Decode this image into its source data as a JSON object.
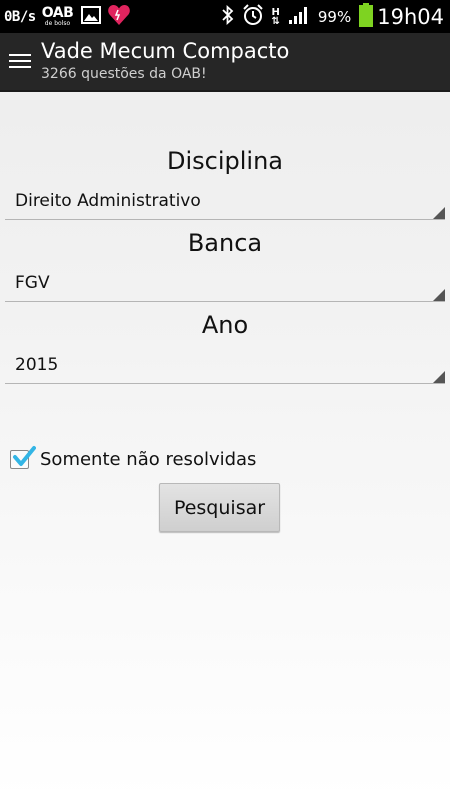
{
  "status_bar": {
    "speed": "0B/s",
    "oab_text": "OAB",
    "oab_small": "de bolso",
    "battery_percent": "99%",
    "time": "19h04",
    "network_type": "H",
    "icons": [
      "image-icon",
      "heart-icon",
      "bluetooth-icon",
      "alarm-icon",
      "signal-icon",
      "battery-icon"
    ]
  },
  "app_bar": {
    "title": "Vade Mecum Compacto",
    "subtitle": "3266 questões da OAB!"
  },
  "form": {
    "disciplina": {
      "label": "Disciplina",
      "value": "Direito Administrativo"
    },
    "banca": {
      "label": "Banca",
      "value": "FGV"
    },
    "ano": {
      "label": "Ano",
      "value": "2015"
    },
    "only_unsolved": {
      "label": "Somente não resolvidas",
      "checked": true
    },
    "search_button": "Pesquisar"
  },
  "colors": {
    "status_bar": "#000000",
    "action_bar": "#262626",
    "checkbox_accent": "#33b5e5",
    "battery": "#7ed321"
  }
}
